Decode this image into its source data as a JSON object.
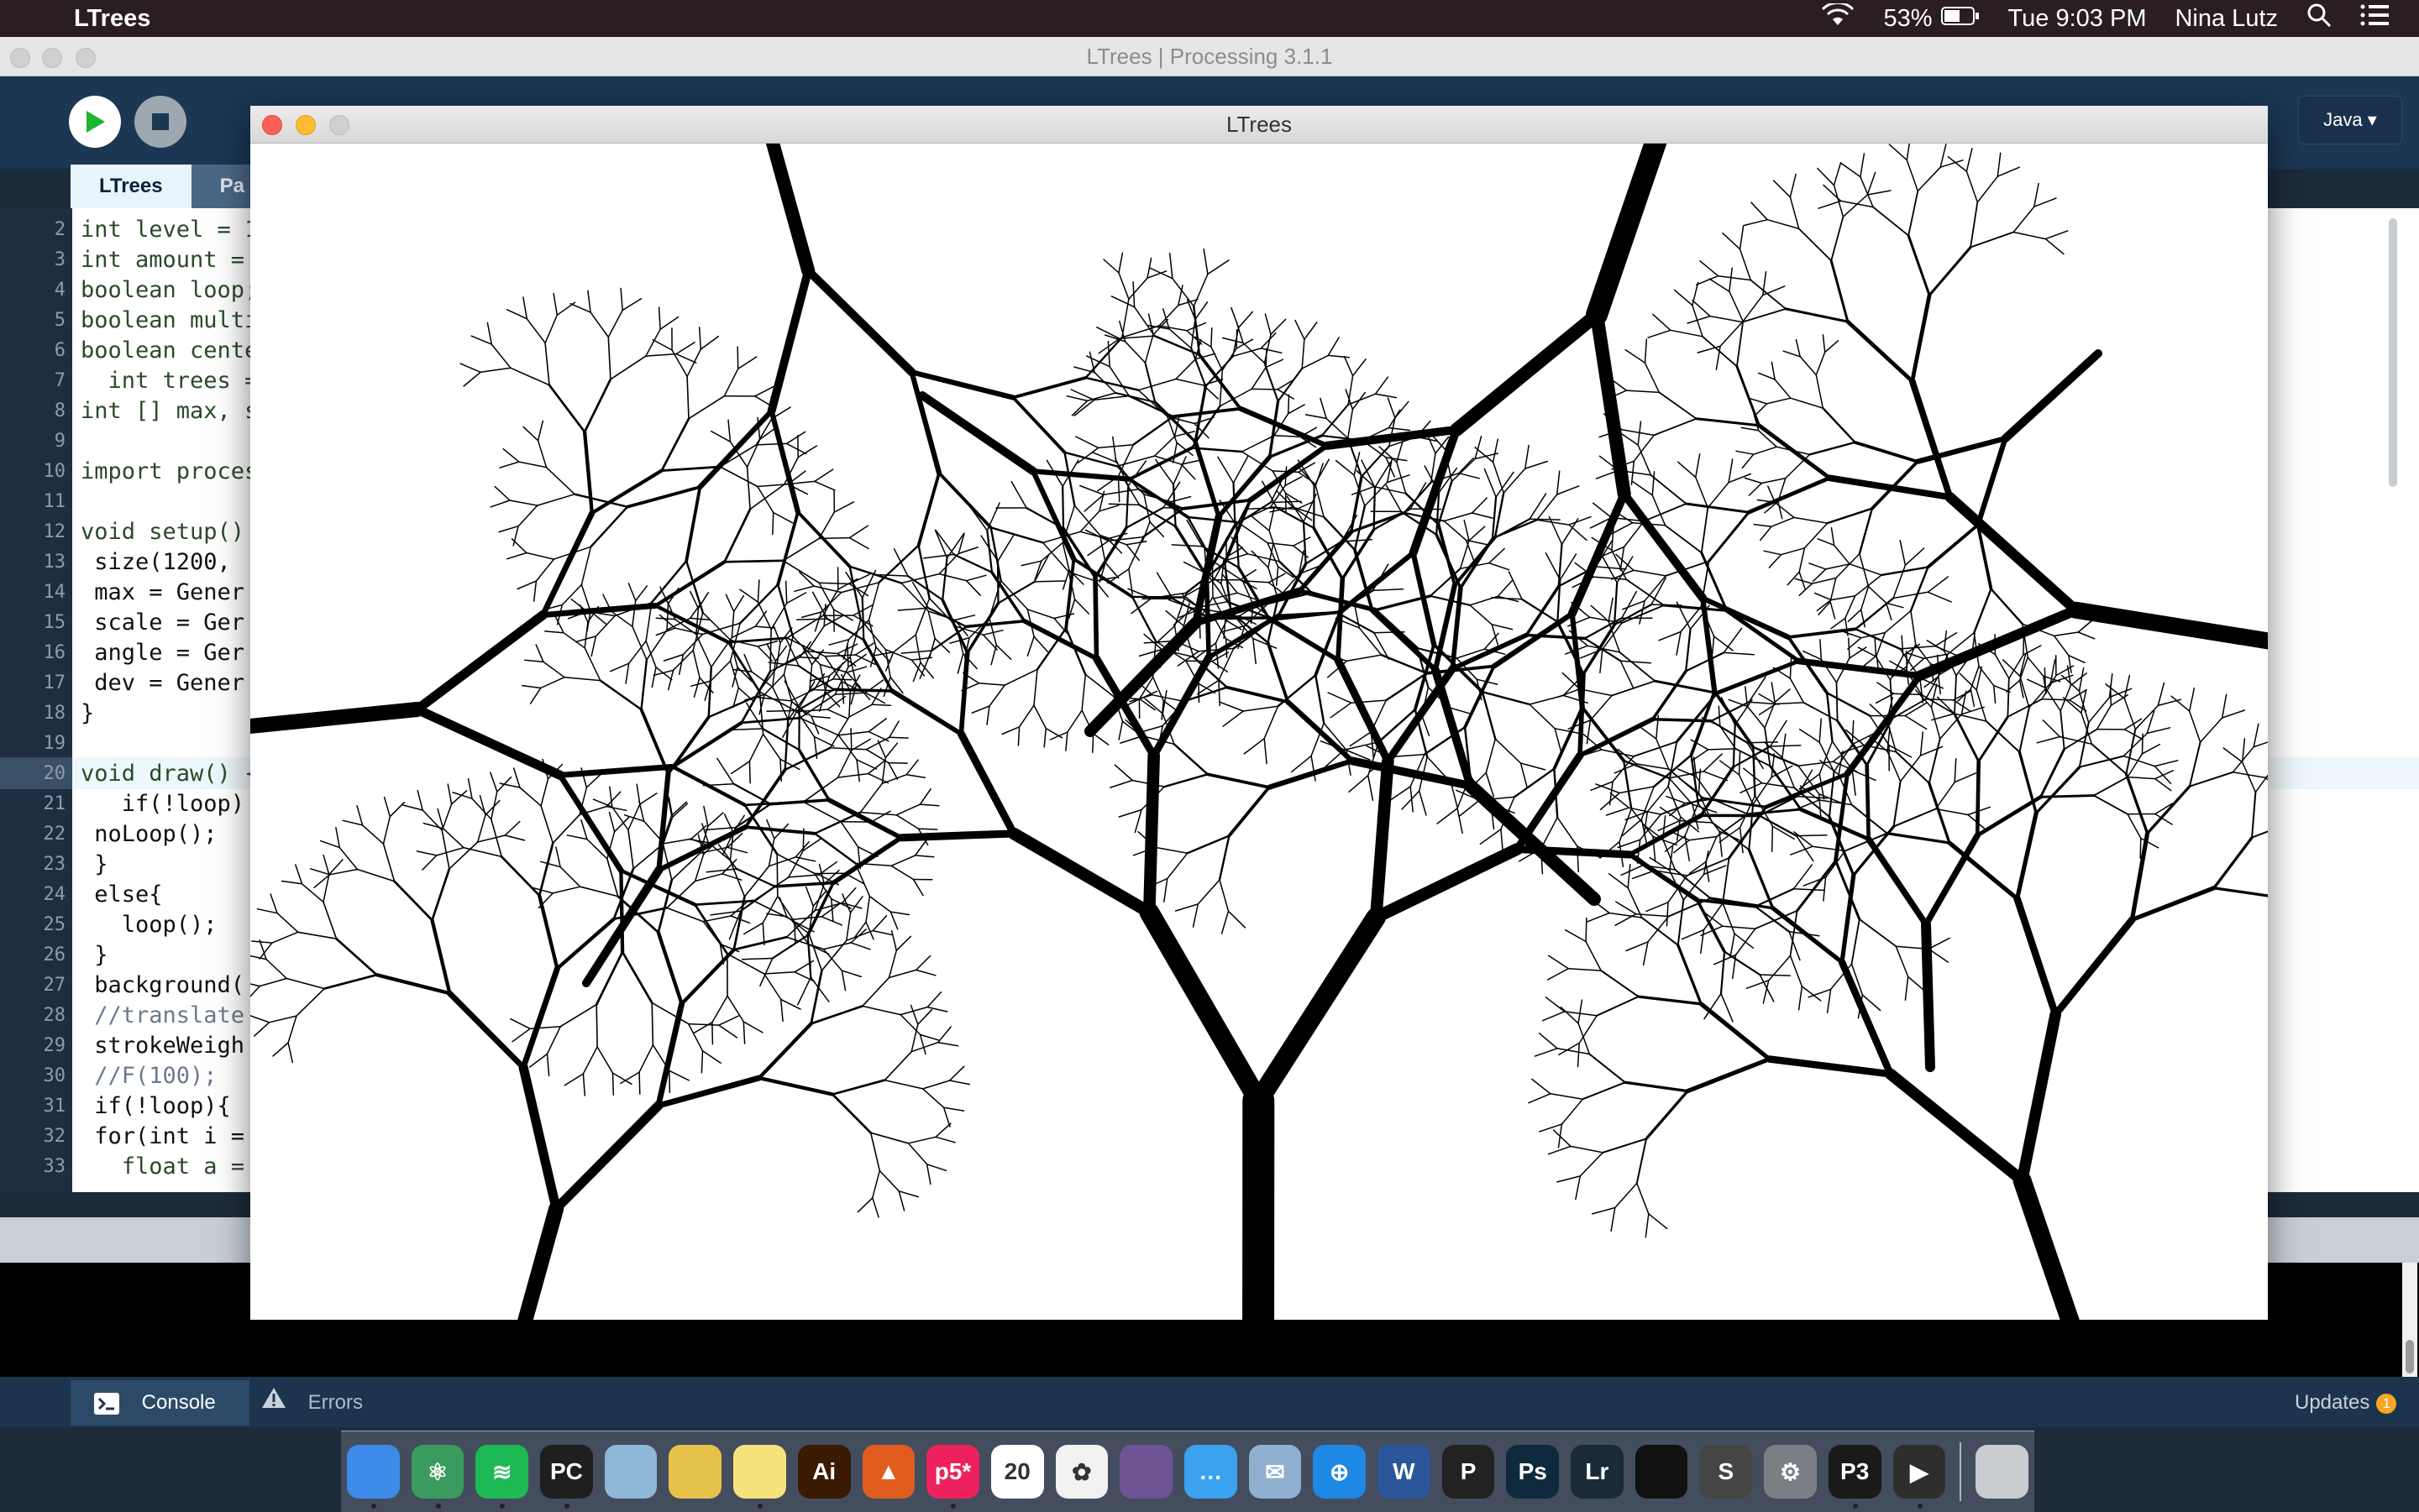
{
  "menubar": {
    "apple_icon": "",
    "app_name": "LTrees",
    "battery": "53%",
    "clock": "Tue 9:03 PM",
    "user": "Nina Lutz"
  },
  "ide": {
    "title": "LTrees | Processing 3.1.1",
    "mode": "Java ▾",
    "tabs": [
      {
        "label": "LTrees"
      },
      {
        "label": "Pa"
      }
    ],
    "code_lines": [
      {
        "n": "2",
        "text": "int level = 1"
      },
      {
        "n": "3",
        "text": "int amount = "
      },
      {
        "n": "4",
        "text": "boolean loop;"
      },
      {
        "n": "5",
        "text": "boolean multi"
      },
      {
        "n": "6",
        "text": "boolean cente"
      },
      {
        "n": "7",
        "text": "  int trees ="
      },
      {
        "n": "8",
        "text": "int [] max, s"
      },
      {
        "n": "9",
        "text": ""
      },
      {
        "n": "10",
        "text": "import proces"
      },
      {
        "n": "11",
        "text": ""
      },
      {
        "n": "12",
        "text": "void setup()"
      },
      {
        "n": "13",
        "text": " size(1200,"
      },
      {
        "n": "14",
        "text": " max = Gener"
      },
      {
        "n": "15",
        "text": " scale = Ger"
      },
      {
        "n": "16",
        "text": " angle = Ger"
      },
      {
        "n": "17",
        "text": " dev = Gener"
      },
      {
        "n": "18",
        "text": "}"
      },
      {
        "n": "19",
        "text": ""
      },
      {
        "n": "20",
        "text": "void draw() {"
      },
      {
        "n": "21",
        "text": "   if(!loop)"
      },
      {
        "n": "22",
        "text": " noLoop();"
      },
      {
        "n": "23",
        "text": " }"
      },
      {
        "n": "24",
        "text": " else{"
      },
      {
        "n": "25",
        "text": "   loop();"
      },
      {
        "n": "26",
        "text": " }"
      },
      {
        "n": "27",
        "text": " background("
      },
      {
        "n": "28",
        "text": " //translate"
      },
      {
        "n": "29",
        "text": " strokeWeigh"
      },
      {
        "n": "30",
        "text": " //F(100);"
      },
      {
        "n": "31",
        "text": " if(!loop){"
      },
      {
        "n": "32",
        "text": " for(int i ="
      },
      {
        "n": "33",
        "text": "   float a ="
      }
    ],
    "status": {
      "console_label": "Console",
      "errors_label": "Errors",
      "updates_label": "Updates",
      "updates_count": "1"
    }
  },
  "sketch": {
    "title": "LTrees"
  },
  "dock": {
    "items": [
      {
        "name": "finder-icon",
        "label": "",
        "color": "#3d8be8",
        "running": true
      },
      {
        "name": "atom-icon",
        "label": "⚛",
        "color": "#3b9b5e",
        "running": true
      },
      {
        "name": "spotify-icon",
        "label": "≋",
        "color": "#1db954",
        "running": true
      },
      {
        "name": "pycharm-icon",
        "label": "PC",
        "color": "#1f1f1f",
        "running": true
      },
      {
        "name": "preview-icon",
        "label": "",
        "color": "#8fb7d8",
        "running": false
      },
      {
        "name": "python-launcher-icon",
        "label": "",
        "color": "#e6c24a",
        "running": false
      },
      {
        "name": "notes-icon",
        "label": "",
        "color": "#f6e27a",
        "running": true
      },
      {
        "name": "illustrator-icon",
        "label": "Ai",
        "color": "#3a1a00",
        "running": false
      },
      {
        "name": "matlab-icon",
        "label": "▲",
        "color": "#e05c1f",
        "running": false
      },
      {
        "name": "p5-icon",
        "label": "p5*",
        "color": "#ed225d",
        "running": true
      },
      {
        "name": "calendar-icon",
        "label": "20",
        "color": "#ffffff",
        "running": false
      },
      {
        "name": "photos-icon",
        "label": "✿",
        "color": "#f2f2f2",
        "running": false
      },
      {
        "name": "github-icon",
        "label": "",
        "color": "#6e5494",
        "running": false
      },
      {
        "name": "messages-icon",
        "label": "…",
        "color": "#3ba2f0",
        "running": false
      },
      {
        "name": "mail-icon",
        "label": "✉",
        "color": "#8fb0d0",
        "running": false
      },
      {
        "name": "safari-icon",
        "label": "⊕",
        "color": "#1e88e5",
        "running": false
      },
      {
        "name": "word-icon",
        "label": "W",
        "color": "#2b579a",
        "running": false
      },
      {
        "name": "processing-icon",
        "label": "P",
        "color": "#222222",
        "running": false
      },
      {
        "name": "photoshop-icon",
        "label": "Ps",
        "color": "#0f2a3d",
        "running": false
      },
      {
        "name": "lightroom-icon",
        "label": "Lr",
        "color": "#1a2a36",
        "running": false
      },
      {
        "name": "activity-monitor-icon",
        "label": "",
        "color": "#111111",
        "running": false
      },
      {
        "name": "sublime-icon",
        "label": "S",
        "color": "#454545",
        "running": false
      },
      {
        "name": "system-preferences-icon",
        "label": "⚙",
        "color": "#7a7f86",
        "running": false
      },
      {
        "name": "processing-3-icon",
        "label": "P3",
        "color": "#1a1a1a",
        "running": true
      },
      {
        "name": "quicktime-icon",
        "label": "▶",
        "color": "#2e2e2e",
        "running": true
      },
      {
        "name": "trash-icon",
        "label": "",
        "color": "#c9cdd2",
        "running": false
      }
    ]
  }
}
